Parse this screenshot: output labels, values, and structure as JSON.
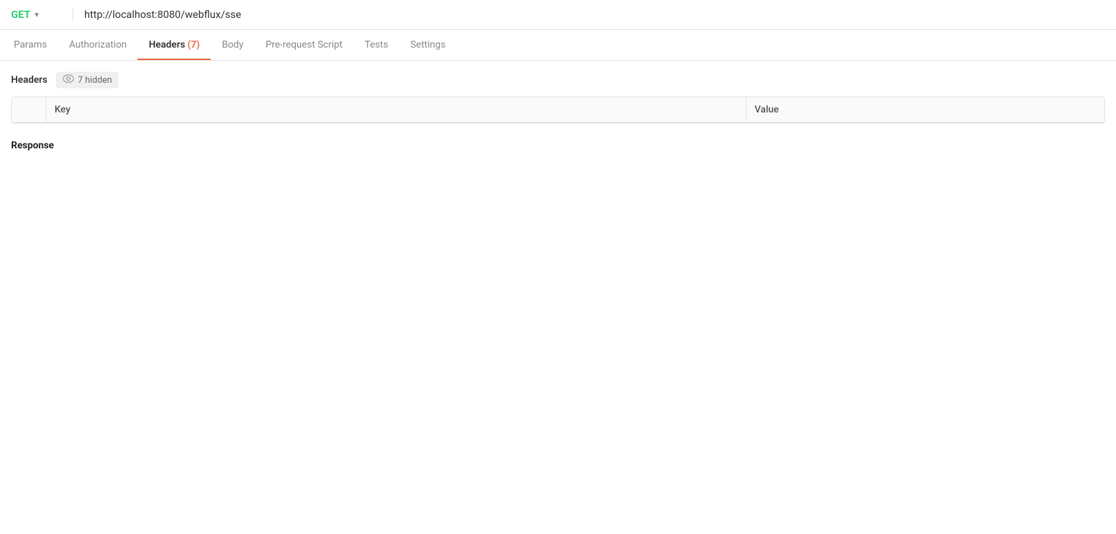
{
  "request_bar": {
    "method": "GET",
    "chevron": "▾",
    "url": "http://localhost:8080/webflux/sse"
  },
  "tabs": [
    {
      "id": "params",
      "label": "Params",
      "active": false
    },
    {
      "id": "authorization",
      "label": "Authorization",
      "active": false
    },
    {
      "id": "headers",
      "label": "Headers",
      "active": true,
      "count": "(7)"
    },
    {
      "id": "body",
      "label": "Body",
      "active": false
    },
    {
      "id": "pre-request-script",
      "label": "Pre-request Script",
      "active": false
    },
    {
      "id": "tests",
      "label": "Tests",
      "active": false
    },
    {
      "id": "settings",
      "label": "Settings",
      "active": false
    }
  ],
  "headers_section": {
    "label": "Headers",
    "hidden_badge": "7 hidden",
    "eye_icon": "👁"
  },
  "table": {
    "col_key": "Key",
    "col_value": "Value"
  },
  "response_section": {
    "label": "Response"
  }
}
